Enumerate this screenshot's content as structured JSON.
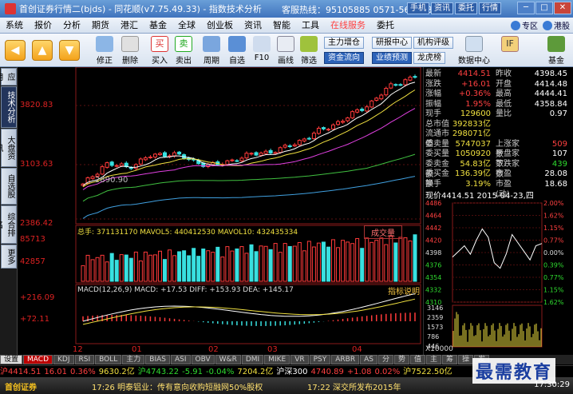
{
  "window": {
    "title": "首创证券行情二(bjds) - 同花顺(v7.75.49.33) - 指数技术分析",
    "hotline": "客服热线：95105885 0571-56768888",
    "top_buttons": [
      "手机",
      "资讯",
      "委托",
      "行情"
    ],
    "controls": [
      "─",
      "□",
      "✕"
    ]
  },
  "menu": {
    "items": [
      "系统",
      "报价",
      "分析",
      "期货",
      "港汇",
      "基金",
      "全球",
      "创业板",
      "资讯",
      "智能",
      "工具",
      "在线服务",
      "委托"
    ],
    "right_tools": [
      "专区",
      "港股"
    ]
  },
  "toolbar": {
    "tools": [
      "修正",
      "删除",
      "买入",
      "卖出",
      "周期",
      "自选",
      "F10",
      "画线",
      "筛选",
      "数据中心",
      "基金"
    ],
    "chips": [
      "主力增仓",
      "研报中心",
      "机构评级",
      "资金流向",
      "业绩预测",
      "龙虎榜"
    ]
  },
  "vtabs": [
    "应用",
    "技术分析",
    "大盘资讯",
    "自选股",
    "综合排名",
    "更多"
  ],
  "chart": {
    "price_labels": [
      "3820.83",
      "3103.63",
      "2386.42"
    ],
    "marked_low": "2890.90",
    "volume_header": "总手: 371131170  MAVOL5: 440412530  MAVOL10: 432435334",
    "volume_button": "成交量",
    "volume_labels": [
      "85713",
      "42857"
    ],
    "macd_header": "MACD(12,26,9)  MACD: +17.53  DIFF: +153.93  DEA: +145.17",
    "macd_button": "指标说明",
    "macd_labels": [
      "+216.09",
      "+72.11"
    ],
    "x_labels": [
      "12",
      "01",
      "02",
      "03",
      "04"
    ]
  },
  "chart_data": {
    "type": "line",
    "title": "",
    "ylim": [
      2386.42,
      4500
    ],
    "categories": [
      "2014-12",
      "2015-01",
      "2015-02",
      "2015-03",
      "2015-04"
    ],
    "series": [
      {
        "values": [
          2900,
          3200,
          3150,
          3300,
          3350,
          3230,
          3170,
          3280,
          3350,
          3400,
          3550,
          3700,
          3850,
          4050,
          4300,
          4414
        ]
      }
    ],
    "volume_ylim": [
      0,
      85713
    ],
    "macd_ylim": [
      -72.11,
      216.09
    ]
  },
  "quote": {
    "rows": [
      {
        "k": "最新",
        "v": "4414.51",
        "k2": "昨收",
        "v2": "4398.45"
      },
      {
        "k": "涨跌",
        "v": "+16.01",
        "k2": "开盘",
        "v2": "4414.48"
      },
      {
        "k": "涨幅",
        "v": "+0.36%",
        "k2": "最高",
        "v2": "4444.41"
      },
      {
        "k": "振幅",
        "v": "1.95%",
        "k2": "最低",
        "v2": "4358.84"
      },
      {
        "k": "现手",
        "v": "129600",
        "k2": "量比",
        "v2": "0.97"
      },
      {
        "k": "总市值",
        "v": "392833亿",
        "k2": "",
        "v2": ""
      },
      {
        "k": "流通市值",
        "v": "298071亿",
        "k2": "",
        "v2": ""
      },
      {
        "k": "委卖量",
        "v": "5747037",
        "k2": "上涨家数",
        "v2": "509"
      },
      {
        "k": "委买量",
        "v": "1050920",
        "k2": "平盘家数",
        "v2": "107"
      },
      {
        "k": "委卖金额",
        "v": "54.83亿",
        "k2": "下跌家数",
        "v2": "439"
      },
      {
        "k": "委买金额",
        "v": "136.39亿",
        "k2": "市盈",
        "v2": "28.08"
      },
      {
        "k": "换手",
        "v": "3.19%",
        "k2": "市盈(动)",
        "v2": "18.68"
      }
    ],
    "intraday_header": "现价4414.51  2015-04-23,四",
    "intraday_left": [
      "4486",
      "4464",
      "4442",
      "4420",
      "4398",
      "4376",
      "4354",
      "4332",
      "4310"
    ],
    "intraday_right": [
      "2.00%",
      "1.62%",
      "1.15%",
      "0.77%",
      "0.00%",
      "0.39%",
      "0.77%",
      "1.15%",
      "1.62%"
    ],
    "volume_axis": [
      "3146",
      "2359",
      "1573",
      "786",
      "446"
    ],
    "volume_unit": "X10000",
    "intraday_series": [
      4390,
      4400,
      4410,
      4395,
      4420,
      4440,
      4425,
      4380,
      4370,
      4395,
      4430,
      4415,
      4400,
      4385,
      4410,
      4414
    ]
  },
  "bottom_tabs": [
    "设置",
    "MACD",
    "KDJ",
    "RSI",
    "BOLL",
    "主力",
    "BIAS",
    "ASI",
    "OBV",
    "W&R",
    "DMI",
    "MIKE",
    "VR",
    "PSY",
    "ARBR",
    "AS",
    "分",
    "势",
    "值",
    "主",
    "筹",
    "操",
    "发"
  ],
  "ticker": [
    {
      "text": "沪4414.51",
      "cls": "red"
    },
    {
      "text": "16.01",
      "cls": "red"
    },
    {
      "text": "0.36%",
      "cls": "red"
    },
    {
      "text": "9630.2亿",
      "cls": "yellow"
    },
    {
      "text": "沪4743.22",
      "cls": "green"
    },
    {
      "text": "-5.91",
      "cls": "green"
    },
    {
      "text": "-0.04%",
      "cls": "green"
    },
    {
      "text": "7204.2亿",
      "cls": "yellow"
    },
    {
      "text": "沪深300",
      "cls": "white"
    },
    {
      "text": "4740.89",
      "cls": "red"
    },
    {
      "text": "+1.08",
      "cls": "red"
    },
    {
      "text": "0.02%",
      "cls": "red"
    },
    {
      "text": "沪7522.50亿",
      "cls": "yellow"
    }
  ],
  "status": {
    "broker": "首创证券",
    "news": "17:26 明泰铝业：传有意向收购短融网50%股权",
    "news2": "17:22 深交所发布2015年",
    "clock": "17:30:29"
  },
  "watermark": "最需教育"
}
